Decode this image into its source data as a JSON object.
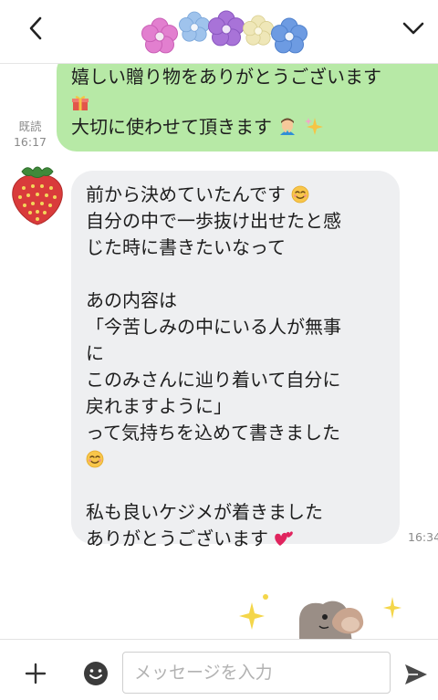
{
  "header": {
    "back_icon": "chevron-left-icon",
    "menu_icon": "chevron-down-icon",
    "title_icon": "flowers-icon"
  },
  "messages": {
    "sent": {
      "lines": [
        "嬉しい贈り物をありがとうございます",
        "",
        "大切に使わせて頂きます"
      ],
      "emoji": [
        "gift-icon",
        "bowing-person-icon",
        "sparkles-icon"
      ],
      "status": "既読",
      "time": "16:17"
    },
    "received": {
      "avatar_icon": "strawberry-icon",
      "lines": [
        "前から決めていたんです",
        "自分の中で一歩抜け出せたと感",
        "じた時に書きたいなって",
        "",
        "あの内容は",
        "「今苦しみの中にいる人が無事",
        "に",
        "このみさんに辿り着いて自分に",
        "戻れますように」",
        "って気持ちを込めて書きました",
        "",
        "",
        "私も良いケジメが着きました",
        "ありがとうございます"
      ],
      "emoji": [
        "smiling-face-icon",
        "smiling-face-icon",
        "two-hearts-icon"
      ],
      "time": "16:34"
    },
    "sticker_icon": "sparkle-sticker-icon"
  },
  "input_bar": {
    "plus_icon": "plus-icon",
    "emoji_icon": "emoji-icon",
    "placeholder": "メッセージを入力",
    "send_icon": "send-icon"
  },
  "colors": {
    "sent_bubble": "#b7e9a6",
    "received_bubble": "#eeeff1",
    "meta_text": "#8a8a8a"
  }
}
